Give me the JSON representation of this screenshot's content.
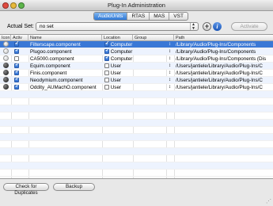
{
  "window": {
    "title": "Plug-In Administration",
    "tabs": [
      {
        "label": "AudioUnits",
        "active": true
      },
      {
        "label": "RTAS",
        "active": false
      },
      {
        "label": "MAS",
        "active": false
      },
      {
        "label": "VST",
        "active": false
      }
    ]
  },
  "toolbar": {
    "actual_set_label": "Actual Set:",
    "actual_set_value": "no set",
    "activate_label": "Activate",
    "add_icon": "plus-icon",
    "info_icon": "info-icon"
  },
  "table": {
    "headers": {
      "icon": "Icon",
      "active": "Activ",
      "name": "Name",
      "location": "Location",
      "group": "Group",
      "path": "Path"
    },
    "rows": [
      {
        "icon": "light",
        "active": true,
        "name": "Filterscape.component",
        "location_checked": true,
        "location": "Computer",
        "path": "/Library/Audio/Plug-Ins/Components"
      },
      {
        "icon": "light",
        "active": true,
        "name": "Plugoo.component",
        "location_checked": true,
        "location": "Computer",
        "path": "/Library/Audio/Plug-Ins/Components"
      },
      {
        "icon": "light",
        "active": false,
        "name": "CA5000.component",
        "location_checked": true,
        "location": "Computer",
        "path": "/Library/Audio/Plug-Ins/Components (Dis"
      },
      {
        "icon": "dark",
        "active": true,
        "name": "Equim.component",
        "location_checked": false,
        "location": "User",
        "path": "/Users/jantiele/Library/Audio/Plug-Ins/C"
      },
      {
        "icon": "dark",
        "active": true,
        "name": "Finis.component",
        "location_checked": false,
        "location": "User",
        "path": "/Users/jantiele/Library/Audio/Plug-Ins/C"
      },
      {
        "icon": "dark",
        "active": true,
        "name": "Neodymium.component",
        "location_checked": false,
        "location": "User",
        "path": "/Users/jantiele/Library/Audio/Plug-Ins/C"
      },
      {
        "icon": "dark",
        "active": true,
        "name": "Oddity_AUMachO.component",
        "location_checked": false,
        "location": "User",
        "path": "/Users/jantiele/Library/Audio/Plug-Ins/C"
      }
    ]
  },
  "buttons": {
    "check_duplicates": "Check for Duplicates",
    "backup": "Backup"
  },
  "colors": {
    "selection": "#3a78d6",
    "row_alt": "#edf3fe",
    "active_tab": "#3a78d6"
  }
}
